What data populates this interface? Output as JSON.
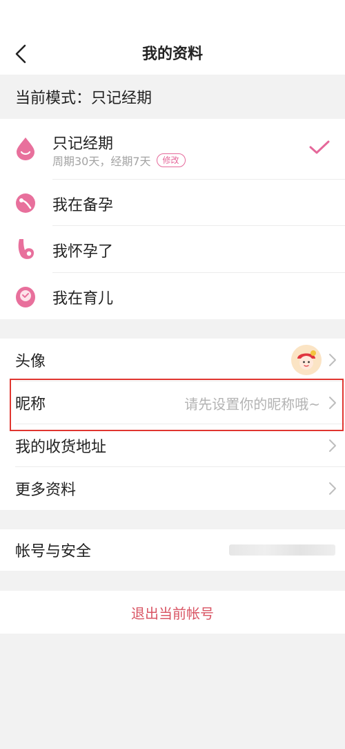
{
  "header": {
    "title": "我的资料"
  },
  "current_mode": {
    "text": "当前模式：只记经期"
  },
  "modes": [
    {
      "label": "只记经期",
      "sub": "周期30天，经期7天",
      "edit": "修改",
      "selected": true
    },
    {
      "label": "我在备孕"
    },
    {
      "label": "我怀孕了"
    },
    {
      "label": "我在育儿"
    }
  ],
  "profile": {
    "avatar_label": "头像",
    "nickname_label": "昵称",
    "nickname_placeholder": "请先设置你的昵称哦~",
    "address_label": "我的收货地址",
    "more_label": "更多资料"
  },
  "account": {
    "label": "帐号与安全"
  },
  "logout": {
    "label": "退出当前帐号"
  },
  "colors": {
    "accent": "#e5689a",
    "highlight": "#e0352f",
    "logout": "#d95564"
  }
}
